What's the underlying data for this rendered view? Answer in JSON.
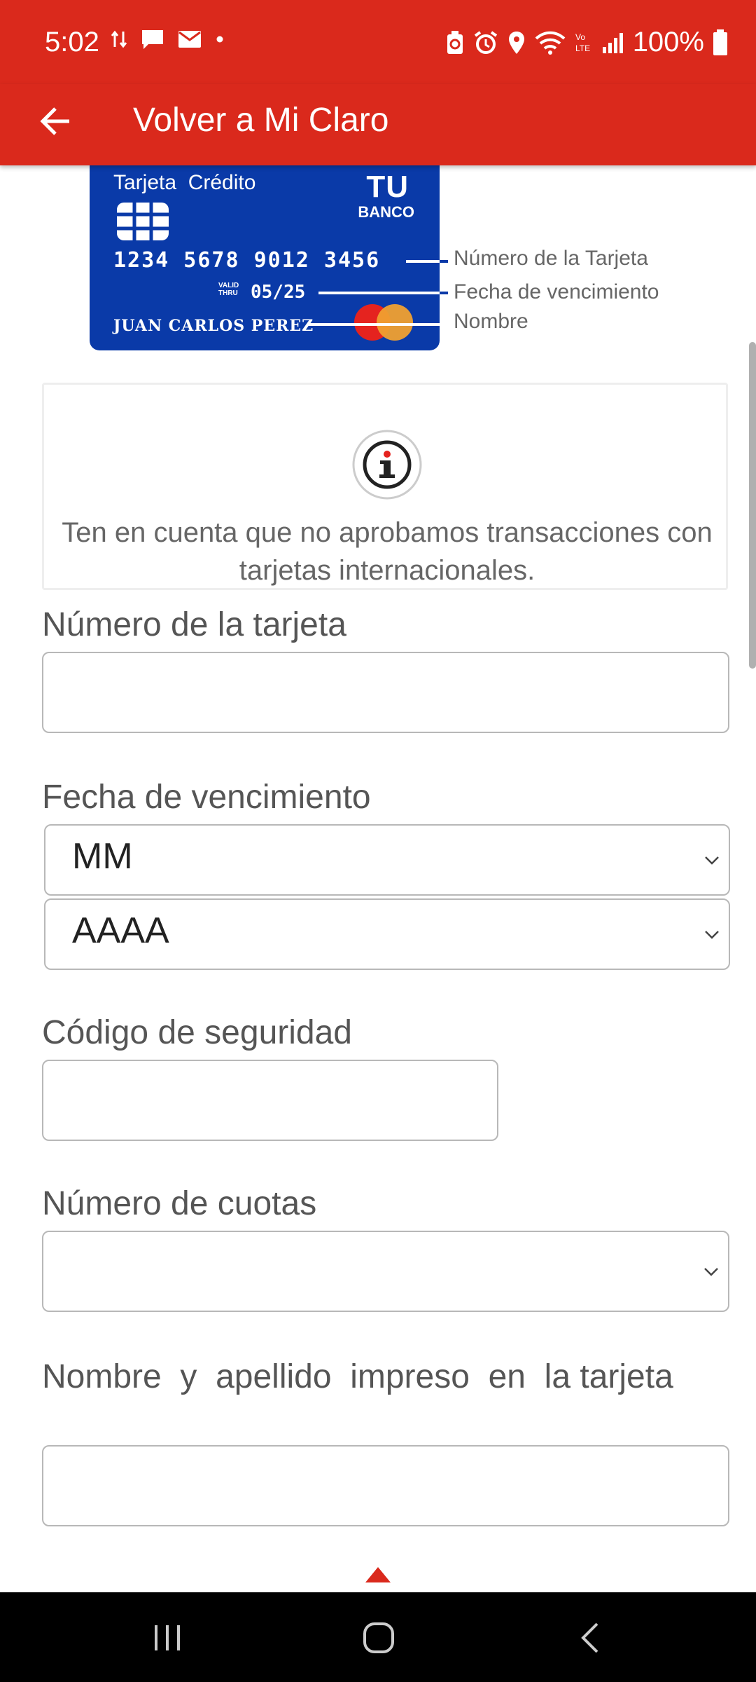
{
  "status_bar": {
    "time": "5:02",
    "battery": "100%",
    "left_icons": [
      "data-transfer-icon",
      "message-icon",
      "mail-icon",
      "dot-icon"
    ],
    "right_icons": [
      "battery-saver-icon",
      "alarm-icon",
      "location-icon",
      "wifi-icon",
      "volte-icon",
      "signal-icon",
      "battery-icon"
    ]
  },
  "header": {
    "title": "Volver a Mi Claro",
    "back_icon": "arrow-left-icon"
  },
  "card": {
    "type_label": "Tarjeta  Crédito",
    "bank_tu": "TU",
    "bank_name": "BANCO",
    "number": "1234 5678 9012 3456",
    "valid_thru": "VALID THRU",
    "expiry": "05/25",
    "holder": "JUAN CARLOS PEREZ",
    "legend": {
      "number": "Número de la Tarjeta",
      "expiry": "Fecha de vencimiento",
      "name": "Nombre"
    }
  },
  "notice": {
    "icon": "info-icon",
    "text": "Ten en cuenta que no aprobamos transacciones con tarjetas internacionales."
  },
  "form": {
    "card_number_label": "Número de la tarjeta",
    "card_number_value": "",
    "expiry_label": "Fecha de vencimiento",
    "month_value": "MM",
    "year_value": "AAAA",
    "cvv_label": "Código de seguridad",
    "cvv_value": "",
    "installments_label": "Número de cuotas",
    "installments_value": "",
    "name_label": "Nombre  y  apellido  impreso  en  la tarjeta",
    "name_value": ""
  },
  "colors": {
    "brand_red": "#da291c",
    "card_blue": "#0a3aa8"
  }
}
